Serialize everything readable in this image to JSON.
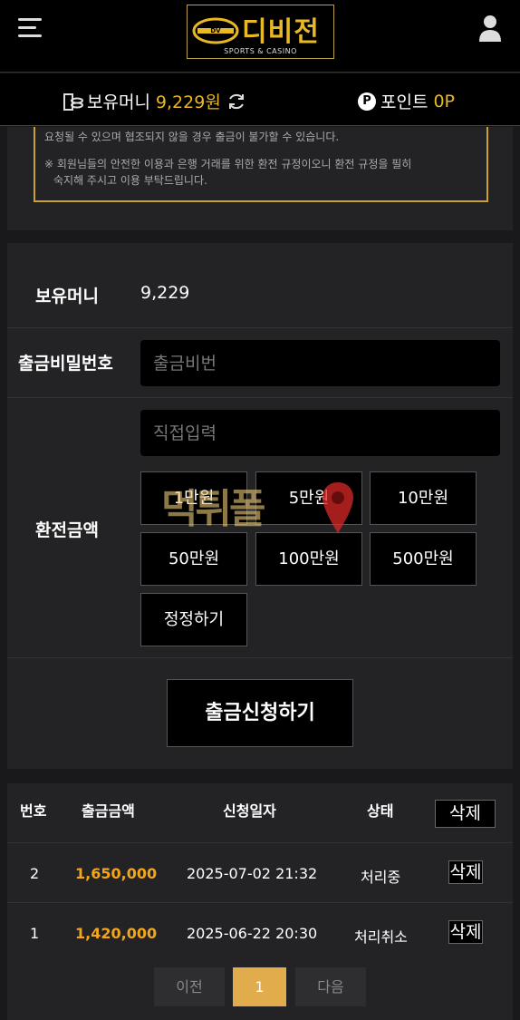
{
  "header": {
    "logo_text": "디비전",
    "logo_sub": "SPORTS & CASINO",
    "logo_emblem": "DV"
  },
  "money_bar": {
    "money_label": "보유머니",
    "money_value": "9,229원",
    "point_icon": "P",
    "point_label": "포인트",
    "point_value": "0P"
  },
  "notice": {
    "lines": [
      "요청될 수 있으며 협조되지 않을 경우 출금이 불가할 수 있습니다.",
      "※ 회원님들의 안전한 이용과 은행 거래를 위한 환전 규정이오니 환전 규정을 필히",
      "숙지해 주시고 이용 부탁드립니다."
    ]
  },
  "form": {
    "balance_label": "보유머니",
    "balance_value": "9,229",
    "password_label": "출금비밀번호",
    "password_placeholder": "출금비번",
    "amount_label": "환전금액",
    "amount_placeholder": "직접입력",
    "amount_buttons": [
      "1만원",
      "5만원",
      "10만원",
      "50만원",
      "100만원",
      "500만원",
      "정정하기"
    ],
    "submit_label": "출금신청하기"
  },
  "watermark": "먹튀폴",
  "table": {
    "headers": [
      "번호",
      "출금금액",
      "신청일자",
      "상태"
    ],
    "header_delete": "삭제",
    "rows": [
      {
        "no": "2",
        "amount": "1,650,000",
        "date": "2025-07-02 21:32",
        "status": "처리중",
        "action": "삭제"
      },
      {
        "no": "1",
        "amount": "1,420,000",
        "date": "2025-06-22 20:30",
        "status": "처리취소",
        "action": "삭제"
      }
    ],
    "pagination": {
      "prev": "이전",
      "current": "1",
      "next": "다음"
    }
  },
  "colors": {
    "accent": "#e8b923",
    "amount": "#f3a51c",
    "page_active": "#e0ac4c"
  }
}
